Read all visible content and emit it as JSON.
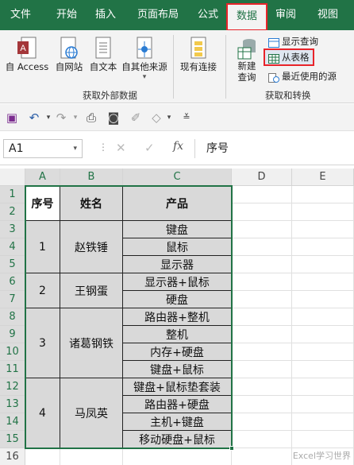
{
  "ribbon_tabs": [
    "文件",
    "开始",
    "插入",
    "页面布局",
    "公式",
    "数据",
    "审阅",
    "视图"
  ],
  "active_tab": "数据",
  "get_external_data": {
    "buttons": [
      "自 Access",
      "自网站",
      "自文本",
      "自其他来源",
      "现有连接"
    ],
    "group_label": "获取外部数据"
  },
  "get_transform": {
    "new_query": "新建\n查询",
    "show_queries": "显示查询",
    "from_table": "从表格",
    "recent_sources": "最近使用的源",
    "group_label": "获取和转换"
  },
  "formula_bar": {
    "name_box": "A1",
    "formula": "序号"
  },
  "columns": [
    "A",
    "B",
    "C",
    "D",
    "E"
  ],
  "rows": [
    "1",
    "2",
    "3",
    "4",
    "5",
    "6",
    "7",
    "8",
    "9",
    "10",
    "11",
    "12",
    "13",
    "14",
    "15",
    "16"
  ],
  "table": {
    "headers": [
      "序号",
      "姓名",
      "产品"
    ],
    "groups": [
      {
        "id": "1",
        "name": "赵铁锤",
        "products": [
          "键盘",
          "鼠标",
          "显示器"
        ]
      },
      {
        "id": "2",
        "name": "王钢蛋",
        "products": [
          "显示器+鼠标",
          "硬盘"
        ]
      },
      {
        "id": "3",
        "name": "诸葛钢铁",
        "products": [
          "路由器+整机",
          "整机",
          "内存+硬盘",
          "键盘+鼠标"
        ]
      },
      {
        "id": "4",
        "name": "马凤英",
        "products": [
          "键盘+鼠标垫套装",
          "路由器+硬盘",
          "主机+键盘",
          "移动硬盘+鼠标"
        ]
      }
    ]
  },
  "watermark": "Excel学习世界",
  "colors": {
    "accent": "#217346",
    "highlight": "#e8242a",
    "cell_fill": "#d9d9d9"
  }
}
